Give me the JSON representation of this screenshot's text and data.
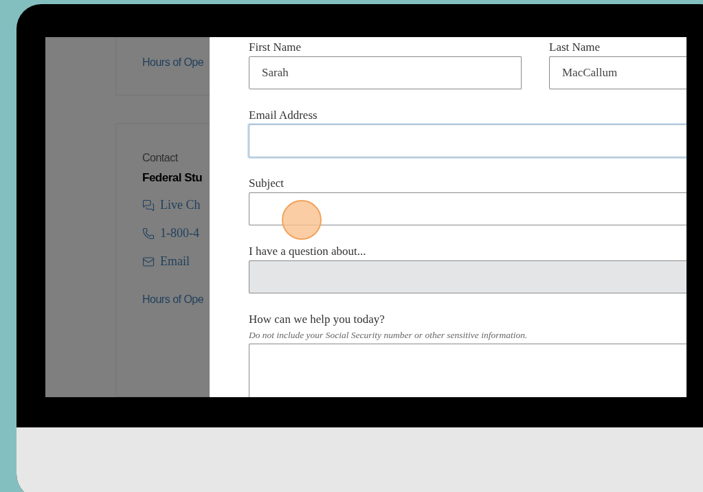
{
  "background_page": {
    "top_card": {
      "link": "Hours of Ope"
    },
    "contact_card": {
      "heading": "Contact",
      "name": "Federal Stu",
      "items": [
        {
          "kind": "chat",
          "label": "Live Ch"
        },
        {
          "kind": "phone",
          "label": "1-800-4"
        },
        {
          "kind": "email",
          "label": "Email"
        }
      ],
      "link": "Hours of Ope"
    }
  },
  "form": {
    "name_row": [
      {
        "label": "First Name",
        "value": "Sarah"
      },
      {
        "label": "Last Name",
        "value": "MacCallum"
      }
    ],
    "fields": [
      {
        "kind": "input",
        "label": "Email Address",
        "focused": true,
        "disabled": false
      },
      {
        "kind": "input",
        "label": "Subject",
        "focused": false,
        "disabled": false
      },
      {
        "kind": "input",
        "label": "I have a question about...",
        "focused": false,
        "disabled": true
      },
      {
        "kind": "textarea",
        "label": "How can we help you today?",
        "hint": "Do not include your Social Security number or other sensitive information.",
        "focused": false,
        "disabled": false
      }
    ]
  }
}
